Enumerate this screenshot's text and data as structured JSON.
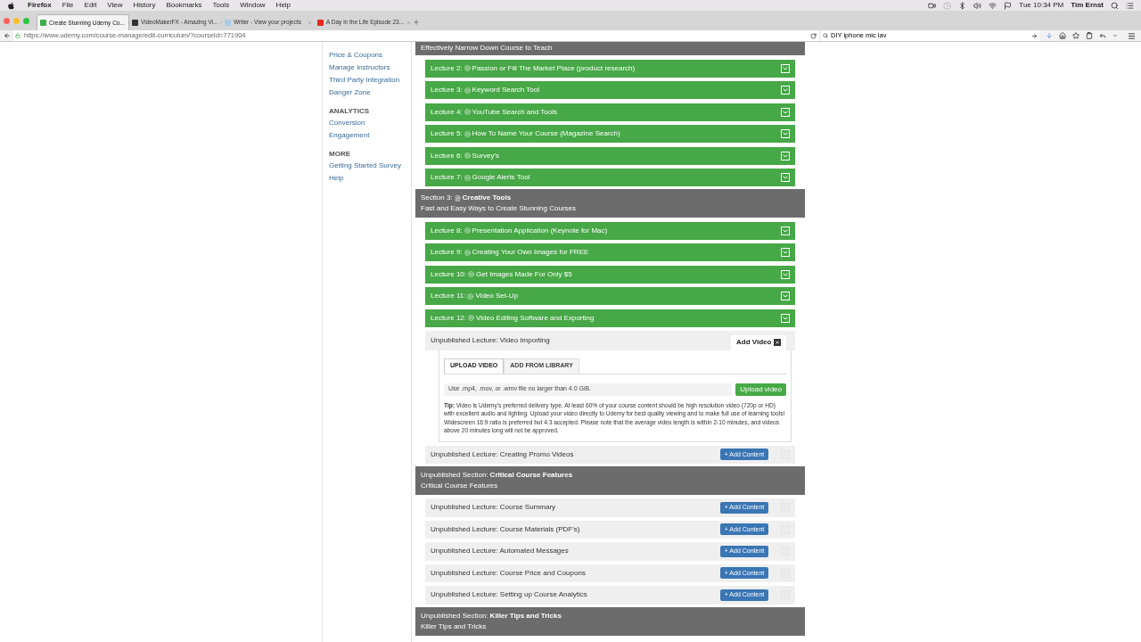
{
  "menu_bar": {
    "app": "Firefox",
    "menus": [
      "File",
      "Edit",
      "View",
      "History",
      "Bookmarks",
      "Tools",
      "Window",
      "Help"
    ],
    "clock": "Tue 10:34 PM",
    "user": "Tim Ernst"
  },
  "browser_tabs": [
    {
      "title": "Create Stunning Udemy Co...",
      "selected": true,
      "color": "#3fae49"
    },
    {
      "title": "VideoMakerFX - Amazing Vi...",
      "selected": false,
      "color": "#333333"
    },
    {
      "title": "Writer - View your projects",
      "selected": false,
      "color": "#a9cbe8"
    },
    {
      "title": "A Day in the Life Episode 23...",
      "selected": false,
      "color": "#e02a20"
    }
  ],
  "address_bar": {
    "url": "https://www.udemy.com/course-manage/edit-curriculum/?courseId=771904"
  },
  "search_bar": {
    "value": "DIY iphone mic lav"
  },
  "sidebar": [
    {
      "items": [
        "Price & Coupons",
        "Manage Instructors",
        "Third Party Integration",
        "Danger Zone"
      ]
    },
    {
      "heading": "ANALYTICS",
      "items": [
        "Conversion",
        "Engagement"
      ]
    },
    {
      "heading": "MORE",
      "items": [
        "Getting Started Survey",
        "Help"
      ]
    }
  ],
  "curriculum": [
    {
      "kind": "section",
      "subtitle": "Effectively Narrow Down Course to Teach"
    },
    {
      "kind": "lecture",
      "label": "Lecture 2:",
      "title": "Passion or Fill The Market Place (product research)"
    },
    {
      "kind": "lecture",
      "label": "Lecture 3:",
      "title": "Keyword Search Tool"
    },
    {
      "kind": "lecture",
      "label": "Lecture 4:",
      "title": "YouTube Search and Tools"
    },
    {
      "kind": "lecture",
      "label": "Lecture 5:",
      "title": "How To Name Your Course (Magazine Search)"
    },
    {
      "kind": "lecture",
      "label": "Lecture 6:",
      "title": "Survey's"
    },
    {
      "kind": "lecture",
      "label": "Lecture 7:",
      "title": "Google Alerts Tool"
    },
    {
      "kind": "section",
      "label": "Section 3:",
      "title": "Creative Tools",
      "subtitle": "Fast and Easy Ways to Create Stunning Courses"
    },
    {
      "kind": "lecture",
      "label": "Lecture 8:",
      "title": "Presentation Application (Keynote for Mac)"
    },
    {
      "kind": "lecture",
      "label": "Lecture 9:",
      "title": "Creating Your Own Images for FREE"
    },
    {
      "kind": "lecture",
      "label": "Lecture 10:",
      "title": "Get Images Made For Only $5"
    },
    {
      "kind": "lecture",
      "label": "Lecture 11:",
      "title": "Video Set-Up"
    },
    {
      "kind": "lecture",
      "label": "Lecture 12:",
      "title": "Video Editing Software and Exporting"
    },
    {
      "kind": "unpublished_lecture",
      "text": "Unpublished Lecture: Video Importing",
      "panel": {
        "title": "Add Video",
        "tabs": [
          {
            "label": "UPLOAD VIDEO",
            "selected": true
          },
          {
            "label": "ADD FROM LIBRARY",
            "selected": false
          }
        ],
        "file_hint": "Use .mp4, .mov, or .wmv file no larger than 4.0 GiB.",
        "button": "Upload video",
        "tip": "**Tip:** Video is Udemy's preferred delivery type. At least 60% of your course content should be high resolution video (720p or HD) with excellent audio and lighting. Upload your video directly to Udemy for best quality viewing and to make full use of learning tools! Widescreen 16:9 ratio is preferred but 4:3 accepted. Please note that the average video length is within 2-10 minutes, and videos above 20 minutes long will not be approved."
      }
    },
    {
      "kind": "unpublished_lecture",
      "text": "Unpublished Lecture: Creating Promo Videos",
      "button": "+ Add Content"
    },
    {
      "kind": "unpublished_section",
      "label": "Unpublished Section:",
      "title": "Critical Course Features",
      "subtitle": "Critical Course Features"
    },
    {
      "kind": "unpublished_lecture",
      "text": "Unpublished Lecture: Course Summary",
      "button": "+ Add Content"
    },
    {
      "kind": "unpublished_lecture",
      "text": "Unpublished Lecture: Course Materials (PDF's)",
      "button": "+ Add Content"
    },
    {
      "kind": "unpublished_lecture",
      "text": "Unpublished Lecture: Automated Messages",
      "button": "+ Add Content"
    },
    {
      "kind": "unpublished_lecture",
      "text": "Unpublished Lecture: Course Price and Coupons",
      "button": "+ Add Content"
    },
    {
      "kind": "unpublished_lecture",
      "text": "Unpublished Lecture: Setting up Course Analytics",
      "button": "+ Add Content"
    },
    {
      "kind": "unpublished_section",
      "label": "Unpublished Section:",
      "title": "Killer Tips and Tricks",
      "subtitle": "Killer Tips and Tricks"
    }
  ]
}
